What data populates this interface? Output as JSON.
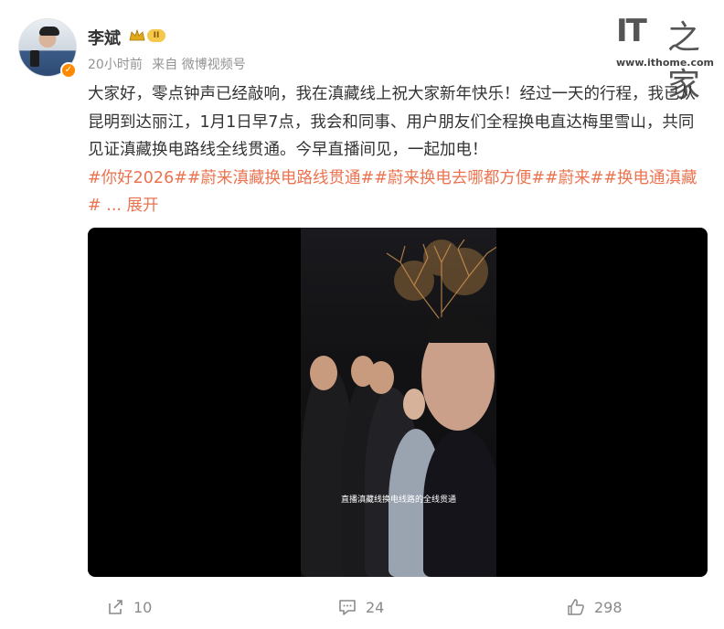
{
  "user": {
    "name": "李斌",
    "level": "II",
    "time": "20小时前",
    "source": "来自 微博视频号"
  },
  "logo": {
    "it": "IT",
    "zhi": "之家",
    "url": "www.ithome.com"
  },
  "post": {
    "text": "大家好，零点钟声已经敲响，我在滇藏线上祝大家新年快乐！经过一天的行程，我已从昆明到达丽江，1月1日早7点，我会和同事、用户朋友们全程换电直达梅里雪山，共同见证滇藏换电路线全线贯通。今早直播间见，一起加电！",
    "tags": "#你好2026##蔚来滇藏换电路线贯通##蔚来换电去哪都方便##蔚来##换电通滇藏#",
    "more": "... 展开"
  },
  "video": {
    "caption": "直播滇藏线换电线路的全线贯通"
  },
  "actions": {
    "share": "10",
    "comment": "24",
    "like": "298"
  },
  "colors": {
    "tag": "#eb7350",
    "meta": "#939393",
    "video_bg": "#000000"
  },
  "icons": [
    "share-icon",
    "comment-icon",
    "like-icon",
    "crown-icon",
    "verified-icon"
  ]
}
